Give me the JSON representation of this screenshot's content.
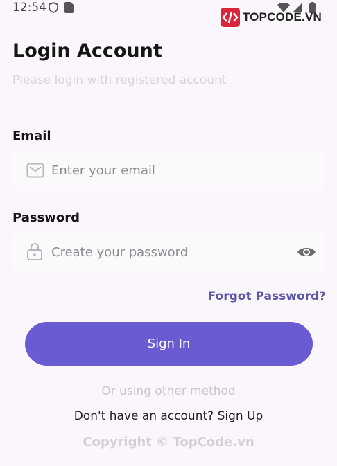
{
  "status_bar": {
    "time": "12:54"
  },
  "watermark": {
    "brand": "TOPCODE.VN"
  },
  "header": {
    "title": "Login Account",
    "subtitle": "Please login with registered account"
  },
  "email": {
    "label": "Email",
    "placeholder": "Enter your email",
    "icon": "mail-icon"
  },
  "password": {
    "label": "Password",
    "placeholder": "Create your password",
    "icon": "lock-icon",
    "toggle_icon": "eye-icon"
  },
  "forgot_password": "Forgot Password?",
  "sign_in_label": "Sign In",
  "other_method": "Or using other method",
  "signup": {
    "prompt": "Don't have an account?",
    "link": "Sign Up"
  },
  "copyright": "Copyright © TopCode.vn",
  "colors": {
    "accent": "#6a5bd2",
    "link": "#5a57a8",
    "background": "#fbf6fb"
  }
}
